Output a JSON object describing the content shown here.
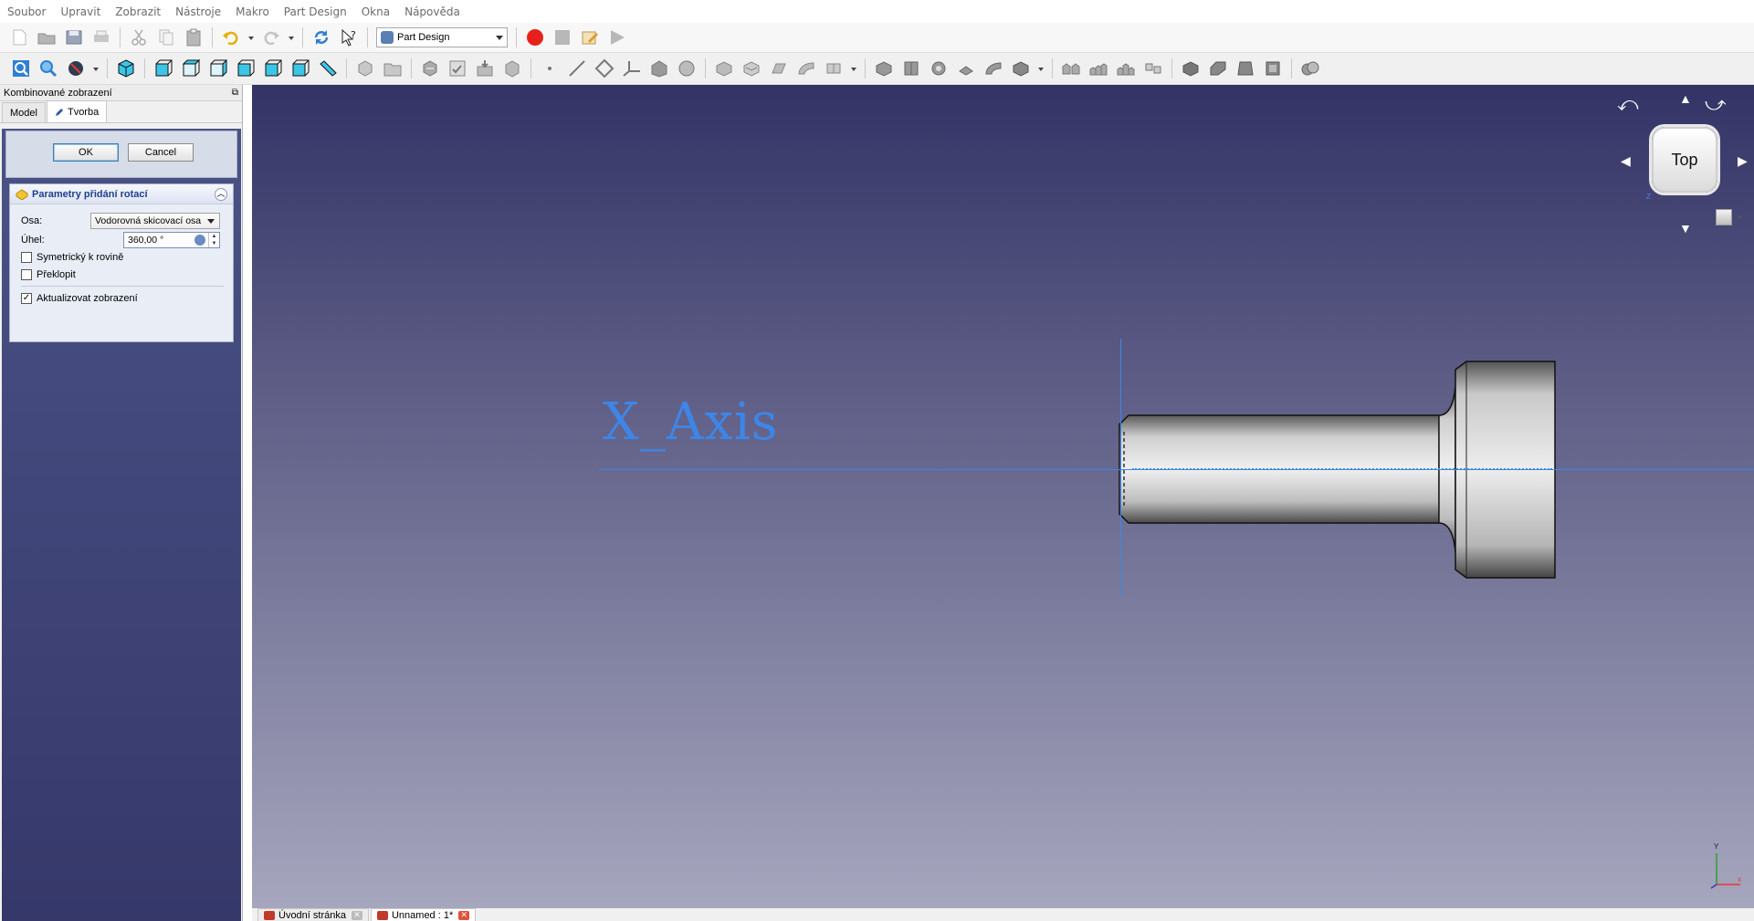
{
  "menu": [
    "Soubor",
    "Upravit",
    "Zobrazit",
    "Nástroje",
    "Makro",
    "Part Design",
    "Okna",
    "Nápověda"
  ],
  "toolbar": {
    "workbench": "Part Design",
    "record_color": "#e8201c"
  },
  "combo": {
    "title": "Kombinované zobrazení",
    "tabs": [
      "Model",
      "Tvorba"
    ]
  },
  "dialog": {
    "ok_label": "OK",
    "cancel_label": "Cancel"
  },
  "params": {
    "title": "Parametry přidání rotací",
    "axis_label": "Osa:",
    "axis_value": "Vodorovná skicovací osa",
    "angle_label": "Úhel:",
    "angle_value": "360,00 °",
    "symmetric_label": "Symetrický k rovině",
    "symmetric_checked": false,
    "reversed_label": "Překlopit",
    "reversed_checked": false,
    "update_view_label": "Aktualizovat zobrazení",
    "update_view_checked": true
  },
  "view3d": {
    "axis_label": "X_Axis",
    "axis_color": "#3d86e8",
    "navcube_face": "Top",
    "navcube_axis_label": "Z",
    "corner_axis_y": "Y",
    "corner_axis_x": "x"
  },
  "doc_tabs": [
    "Úvodní stránka",
    "Unnamed : 1*"
  ]
}
